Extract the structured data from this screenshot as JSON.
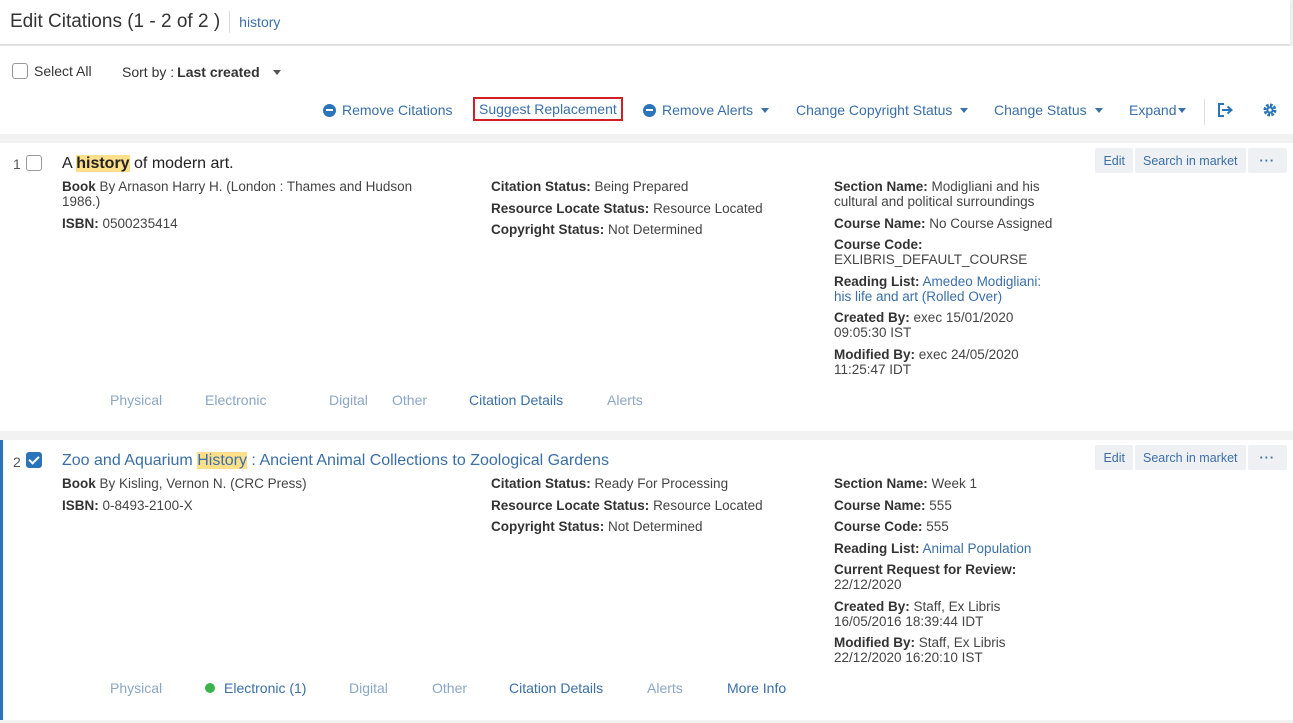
{
  "header": {
    "title": "Edit Citations (1 - 2 of 2 )",
    "breadcrumb": "history"
  },
  "controls": {
    "select_all": "Select All",
    "sort_by_label": "Sort by :",
    "sort_by_value": "Last created"
  },
  "toolbar": {
    "remove_citations": "Remove Citations",
    "suggest_replacement": "Suggest Replacement",
    "remove_alerts": "Remove Alerts",
    "change_copyright": "Change Copyright Status",
    "change_status": "Change Status",
    "expand": "Expand",
    "highlight_color": "#d21f26"
  },
  "card_actions": {
    "edit": "Edit",
    "search_market": "Search in market",
    "more": "···"
  },
  "citations": [
    {
      "num": "1",
      "checked": false,
      "title_pre": "A ",
      "title_hl": "history",
      "title_post": " of modern art.",
      "type": "Book",
      "by": "By Arnason Harry H. (London : Thames and Hudson 1986.)",
      "isbn_label": "ISBN:",
      "isbn": "0500235414",
      "citation_status": "Being Prepared",
      "resource_locate_status": "Resource Located",
      "copyright_status": "Not Determined",
      "section_name": "Modigliani and his cultural and political surroundings",
      "course_name": "No Course Assigned",
      "course_code": "EXLIBRIS_DEFAULT_COURSE",
      "reading_list": "Amedeo Modigliani: his life and art (Rolled Over)",
      "created_by": "exec 15/01/2020 09:05:30 IST",
      "modified_by": "exec 24/05/2020 11:25:47 IDT",
      "tabs": [
        "Physical",
        "Electronic",
        "Digital",
        "Other",
        "Citation Details",
        "Alerts"
      ]
    },
    {
      "num": "2",
      "checked": true,
      "title_pre": "Zoo and Aquarium ",
      "title_hl": "History",
      "title_post": " : Ancient Animal Collections to Zoological Gardens",
      "type": "Book",
      "by": "By Kisling, Vernon N. (CRC Press)",
      "isbn_label": "ISBN:",
      "isbn": "0-8493-2100-X",
      "citation_status": "Ready For Processing",
      "resource_locate_status": "Resource Located",
      "copyright_status": "Not Determined",
      "section_name": "Week 1",
      "course_name": "555",
      "course_code": "555",
      "reading_list": "Animal Population",
      "current_request_review": "22/12/2020",
      "created_by": "Staff, Ex Libris 16/05/2016 18:39:44 IDT",
      "modified_by": "Staff, Ex Libris 22/12/2020 16:20:10 IST",
      "tabs": [
        "Physical",
        "Electronic (1)",
        "Digital",
        "Other",
        "Citation Details",
        "Alerts",
        "More Info"
      ]
    }
  ],
  "labels": {
    "citation_status": "Citation Status:",
    "resource_locate_status": "Resource Locate Status:",
    "copyright_status": "Copyright Status:",
    "section_name": "Section Name:",
    "course_name": "Course Name:",
    "course_code": "Course Code:",
    "reading_list": "Reading List:",
    "current_request_review": "Current Request for Review:",
    "created_by": "Created By:",
    "modified_by": "Modified By:"
  }
}
